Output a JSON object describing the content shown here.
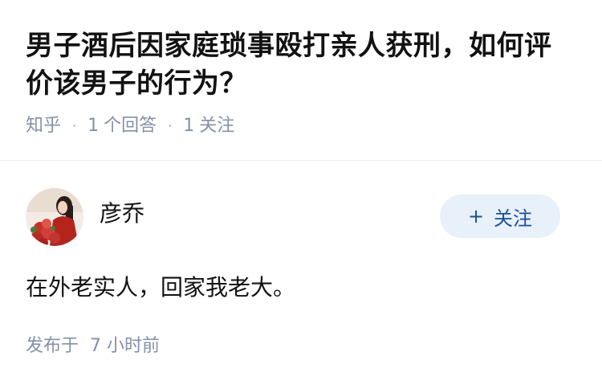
{
  "question": {
    "title": "男子酒后因家庭琐事殴打亲人获刑，如何评价该男子的行为？",
    "source": "知乎",
    "answer_count_num": "1",
    "answer_count_label": "个回答",
    "follower_count_num": "1",
    "follower_count_label": "关注"
  },
  "answer": {
    "author_name": "彦乔",
    "avatar_icon": "avatar-photo",
    "follow_button_label": "关注",
    "follow_button_plus": "+",
    "content": "在外老实人，回家我老大。",
    "published_label": "发布于",
    "published_time": "7 小时前"
  },
  "colors": {
    "meta_gray": "#8590a6",
    "follow_bg": "#e8f0fa",
    "follow_text": "#175199"
  }
}
